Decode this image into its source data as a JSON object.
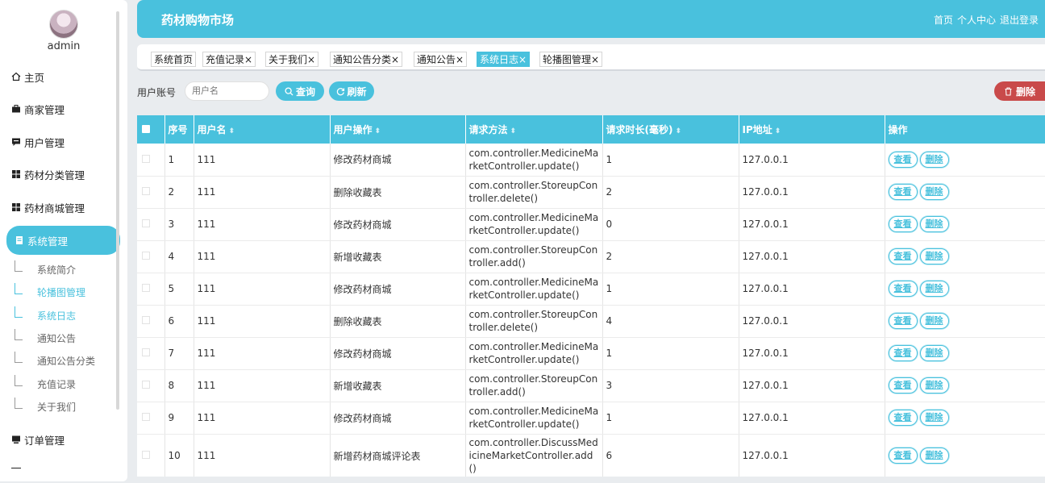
{
  "sidebar": {
    "username": "admin",
    "menu": [
      {
        "label": "主页",
        "icon": "home-icon"
      },
      {
        "label": "商家管理",
        "icon": "briefcase-icon"
      },
      {
        "label": "用户管理",
        "icon": "chat-icon"
      },
      {
        "label": "药材分类管理",
        "icon": "grid-icon"
      },
      {
        "label": "药材商城管理",
        "icon": "grid-icon"
      },
      {
        "label": "系统管理",
        "icon": "doc-icon"
      },
      {
        "label": "订单管理",
        "icon": "monitor-icon"
      }
    ],
    "submenu": [
      "系统简介",
      "轮播图管理",
      "系统日志",
      "通知公告",
      "通知公告分类",
      "充值记录",
      "关于我们"
    ]
  },
  "header": {
    "title": "药材购物市场",
    "links": [
      "首页",
      "个人中心",
      "退出登录"
    ]
  },
  "tabs": [
    "系统首页",
    "充值记录",
    "关于我们",
    "通知公告分类",
    "通知公告",
    "系统日志",
    "轮播图管理"
  ],
  "tab_close": "×",
  "search": {
    "label": "用户账号",
    "placeholder": "用户名",
    "query_label": "查询",
    "refresh_label": "刷新",
    "delete_label": "删除"
  },
  "table": {
    "headers": [
      "序号",
      "用户名",
      "用户操作",
      "请求方法",
      "请求时长(毫秒)",
      "IP地址",
      "操作"
    ],
    "view_label": "查看",
    "delete_label": "删除",
    "rows": [
      {
        "no": "1",
        "user": "111",
        "op": "修改药材商城",
        "method": "com.controller.MedicineMarketController.update()",
        "ms": "1",
        "ip": "127.0.0.1"
      },
      {
        "no": "2",
        "user": "111",
        "op": "删除收藏表",
        "method": "com.controller.StoreupController.delete()",
        "ms": "2",
        "ip": "127.0.0.1"
      },
      {
        "no": "3",
        "user": "111",
        "op": "修改药材商城",
        "method": "com.controller.MedicineMarketController.update()",
        "ms": "0",
        "ip": "127.0.0.1"
      },
      {
        "no": "4",
        "user": "111",
        "op": "新增收藏表",
        "method": "com.controller.StoreupController.add()",
        "ms": "2",
        "ip": "127.0.0.1"
      },
      {
        "no": "5",
        "user": "111",
        "op": "修改药材商城",
        "method": "com.controller.MedicineMarketController.update()",
        "ms": "1",
        "ip": "127.0.0.1"
      },
      {
        "no": "6",
        "user": "111",
        "op": "删除收藏表",
        "method": "com.controller.StoreupController.delete()",
        "ms": "4",
        "ip": "127.0.0.1"
      },
      {
        "no": "7",
        "user": "111",
        "op": "修改药材商城",
        "method": "com.controller.MedicineMarketController.update()",
        "ms": "1",
        "ip": "127.0.0.1"
      },
      {
        "no": "8",
        "user": "111",
        "op": "新增收藏表",
        "method": "com.controller.StoreupController.add()",
        "ms": "3",
        "ip": "127.0.0.1"
      },
      {
        "no": "9",
        "user": "111",
        "op": "修改药材商城",
        "method": "com.controller.MedicineMarketController.update()",
        "ms": "1",
        "ip": "127.0.0.1"
      },
      {
        "no": "10",
        "user": "111",
        "op": "新增药材商城评论表",
        "method": "com.controller.DiscussMedicineMarketController.add()",
        "ms": "6",
        "ip": "127.0.0.1"
      }
    ]
  }
}
